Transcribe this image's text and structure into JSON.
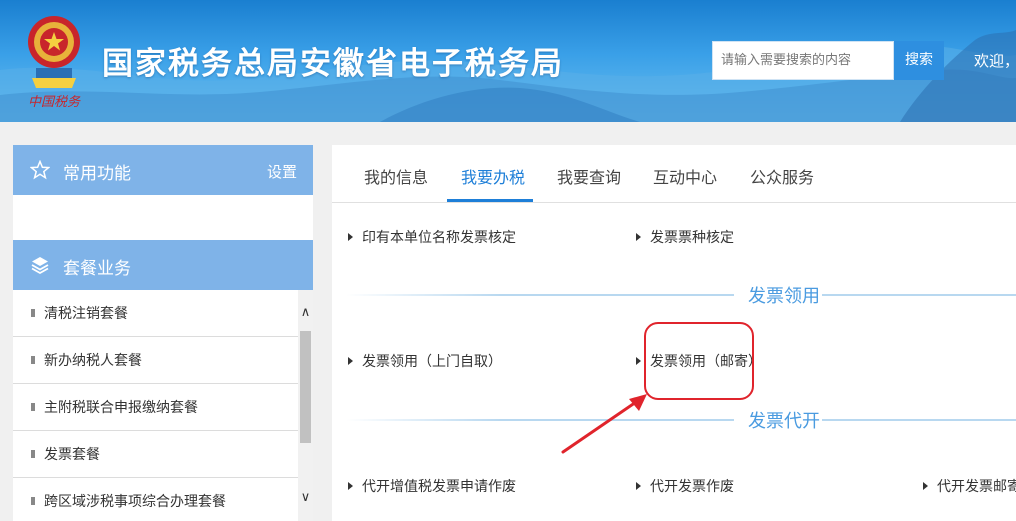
{
  "header": {
    "site_title": "国家税务总局安徽省电子税务局",
    "search_placeholder": "请输入需要搜索的内容",
    "search_button": "搜索",
    "welcome": "欢迎，",
    "logo_caption": "中国税务"
  },
  "sidebar": {
    "common_functions": {
      "title": "常用功能",
      "settings": "设置",
      "icon": "star-icon"
    },
    "package_business": {
      "title": "套餐业务",
      "icon": "layers-icon"
    },
    "items": [
      {
        "label": "清税注销套餐"
      },
      {
        "label": "新办纳税人套餐"
      },
      {
        "label": "主附税联合申报缴纳套餐"
      },
      {
        "label": "发票套餐"
      },
      {
        "label": "跨区域涉税事项综合办理套餐"
      }
    ]
  },
  "main": {
    "tabs": [
      {
        "label": "我的信息",
        "active": false
      },
      {
        "label": "我要办税",
        "active": true
      },
      {
        "label": "我要查询",
        "active": false
      },
      {
        "label": "互动中心",
        "active": false
      },
      {
        "label": "公众服务",
        "active": false
      }
    ],
    "top_items": [
      {
        "label": "印有本单位名称发票核定"
      },
      {
        "label": "发票票种核定"
      }
    ],
    "sections": [
      {
        "title": "发票领用",
        "items": [
          {
            "label": "发票领用（上门自取）"
          },
          {
            "label": "发票领用（邮寄）",
            "highlighted": true
          }
        ]
      },
      {
        "title": "发票代开",
        "items": [
          {
            "label": "代开增值税发票申请作废"
          },
          {
            "label": "代开发票作废"
          },
          {
            "label": "代开发票邮寄"
          }
        ]
      }
    ]
  },
  "colors": {
    "accent": "#1e7fd8",
    "panel_header": "#7fb3e8",
    "section_title": "#4a9be0",
    "highlight": "#e0242c"
  }
}
